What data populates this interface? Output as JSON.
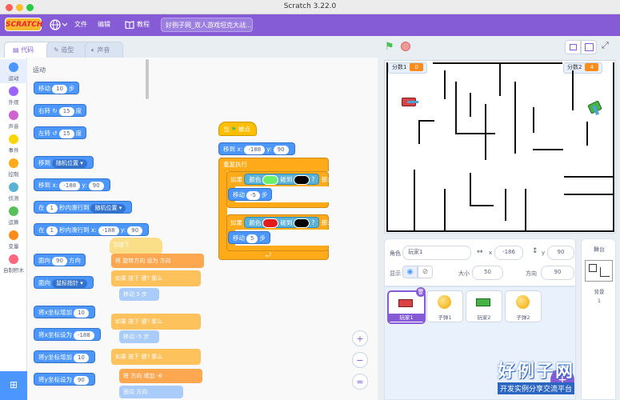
{
  "window": {
    "title": "Scratch 3.22.0"
  },
  "menubar": {
    "logo": "SCRATCH",
    "file": "文件",
    "edit": "编辑",
    "tutorials": "教程",
    "project_title": "好例子网_双人游戏坦克大战..."
  },
  "tabs": {
    "code": "代码",
    "costumes": "造型",
    "sounds": "声音"
  },
  "categories": [
    {
      "label": "运动",
      "color": "#4c97ff"
    },
    {
      "label": "外观",
      "color": "#9966ff"
    },
    {
      "label": "声音",
      "color": "#cf63cf"
    },
    {
      "label": "事件",
      "color": "#ffd500"
    },
    {
      "label": "控制",
      "color": "#ffab19"
    },
    {
      "label": "侦测",
      "color": "#5cb1d6"
    },
    {
      "label": "运算",
      "color": "#59c059"
    },
    {
      "label": "变量",
      "color": "#ff8c1a"
    },
    {
      "label": "自制积木",
      "color": "#ff6680"
    }
  ],
  "palette": {
    "section": "运动",
    "move": {
      "a": "移动",
      "v": "10",
      "b": "步"
    },
    "turn_right": {
      "a": "右转",
      "v": "15",
      "b": "度"
    },
    "turn_left": {
      "a": "左转",
      "v": "15",
      "b": "度"
    },
    "goto": {
      "a": "移到",
      "d": "随机位置"
    },
    "goto_xy": {
      "a": "移到 x:",
      "x": "-188",
      "b": "y:",
      "y": "90"
    },
    "glide": {
      "a": "在",
      "v": "1",
      "b": "秒内滑行到",
      "d": "随机位置"
    },
    "glide_xy": {
      "a": "在",
      "v": "1",
      "b": "秒内滑行到 x:",
      "x": "-188",
      "c": "y:",
      "y": "90"
    },
    "point_dir": {
      "a": "面向",
      "v": "90",
      "b": "方向"
    },
    "point_towards": {
      "a": "面向",
      "d": "鼠标指针"
    },
    "change_x": {
      "a": "将x坐标增加",
      "v": "10"
    },
    "set_x": {
      "a": "将x坐标设为",
      "v": "-188"
    },
    "change_y": {
      "a": "将y坐标增加",
      "v": "10"
    },
    "set_y": {
      "a": "将y坐标设为",
      "v": "90"
    }
  },
  "script": {
    "hat": {
      "a": "当",
      "b": "被点击"
    },
    "goto": {
      "a": "移到 x:",
      "x": "-188",
      "b": "y:",
      "y": "90"
    },
    "forever": "重复执行",
    "if1": {
      "a": "如果",
      "b": "颜色",
      "c1": "#6cf06c",
      "c": "碰到",
      "c2": "#000000",
      "d": "?",
      "e": "那么"
    },
    "move1": {
      "a": "移动",
      "v": "-5",
      "b": "步"
    },
    "if2": {
      "a": "如果",
      "b": "颜色",
      "c1": "#e21b1b",
      "c": "碰到",
      "c2": "#000000",
      "d": "?",
      "e": "那么"
    },
    "move2": {
      "a": "移动",
      "v": "5",
      "b": "步"
    }
  },
  "ghost": {
    "g1": "当按下",
    "g2": "将 旋转方向 设为 方向",
    "g3": "如果 按下 键? 那么",
    "g4": "移动 5 步",
    "g5": "如果 按下 键? 那么",
    "g6": "移动 -5 步",
    "g7": "如果 按下 键? 那么",
    "g8": "将 方向 增加 -6",
    "g9": "面向 方向"
  },
  "zoom": {
    "in": "+",
    "out": "−",
    "reset": "="
  },
  "stage": {
    "score1_label": "分数1",
    "score1": "0",
    "score2_label": "分数2",
    "score2": "4"
  },
  "sprite_info": {
    "sprite_label": "角色",
    "sprite_name": "玩家1",
    "x_label": "x",
    "x": "-186",
    "y_label": "y",
    "y": "90",
    "show_label": "显示",
    "size_label": "大小",
    "size": "50",
    "direction_label": "方向",
    "direction": "90"
  },
  "sprites": [
    {
      "name": "玩家1"
    },
    {
      "name": "子弹1"
    },
    {
      "name": "玩家2"
    },
    {
      "name": "子弹2"
    }
  ],
  "stage_pane": {
    "title": "舞台",
    "backdrop_label": "背景",
    "backdrop_count": "1"
  },
  "watermark": {
    "title": "好例子网",
    "subtitle": "开发实例分享交流平台"
  }
}
